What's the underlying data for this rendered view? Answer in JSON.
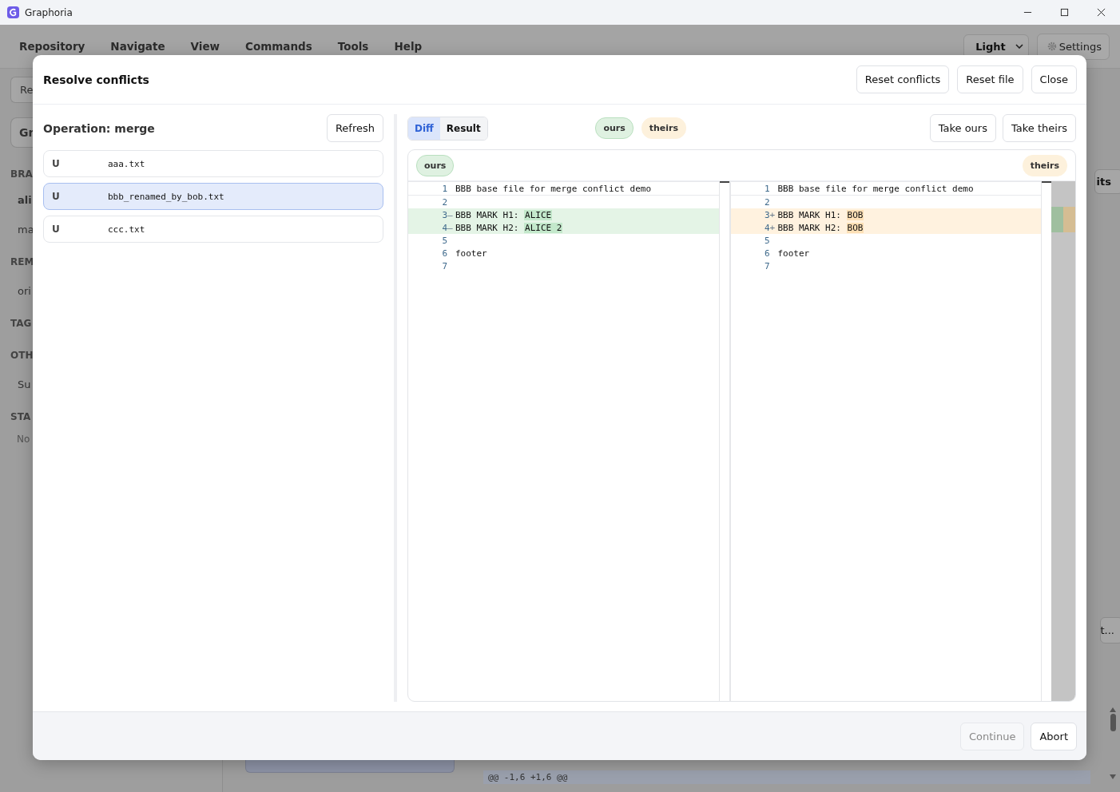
{
  "window": {
    "title": "Graphoria"
  },
  "menu": [
    "Repository",
    "Navigate",
    "View",
    "Commands",
    "Tools",
    "Help"
  ],
  "theme_select": {
    "value": "Light"
  },
  "settings_button": {
    "label": "Settings"
  },
  "background": {
    "sidebar": [
      {
        "text": "Re",
        "kind": "button"
      },
      {
        "text": "Gr",
        "kind": "bigbutton"
      },
      {
        "text": "BRA",
        "kind": "header"
      },
      {
        "text": "ali",
        "kind": "current"
      },
      {
        "text": "ma",
        "kind": "item"
      },
      {
        "text": "REM",
        "kind": "header"
      },
      {
        "text": "ori",
        "kind": "item"
      },
      {
        "text": "TAG",
        "kind": "header"
      },
      {
        "text": "OTH",
        "kind": "header"
      },
      {
        "text": "Su",
        "kind": "item"
      },
      {
        "text": "STA",
        "kind": "header"
      },
      {
        "text": "No",
        "kind": "muted"
      }
    ],
    "right": [
      {
        "text": "its",
        "kind": "bold"
      },
      {
        "text": "t...",
        "kind": "plain"
      }
    ],
    "diff_line": "@@ -1,6 +1,6 @@"
  },
  "dialog": {
    "title": "Resolve conflicts",
    "header_buttons": [
      "Reset conflicts",
      "Reset file",
      "Close"
    ],
    "operation": "Operation: merge",
    "refresh": "Refresh",
    "files": [
      {
        "status": "U",
        "name": "aaa.txt",
        "selected": false
      },
      {
        "status": "U",
        "name": "bbb_renamed_by_bob.txt",
        "selected": true
      },
      {
        "status": "U",
        "name": "ccc.txt",
        "selected": false
      }
    ],
    "view_tabs": [
      {
        "label": "Diff",
        "selected": true
      },
      {
        "label": "Result",
        "selected": false
      }
    ],
    "legend": [
      {
        "label": "ours",
        "kind": "ours"
      },
      {
        "label": "theirs",
        "kind": "theirs"
      }
    ],
    "take_buttons": [
      "Take ours",
      "Take theirs"
    ],
    "panes": [
      {
        "label": "ours",
        "kind": "ours",
        "lines": [
          {
            "num": "1",
            "text": "BBB base file for merge conflict demo",
            "changed": false
          },
          {
            "num": "2",
            "changed": false
          },
          {
            "num": "3",
            "sign": "—",
            "text": "BBB MARK H1: ",
            "highlight": "ALICE",
            "changed": true
          },
          {
            "num": "4",
            "sign": "—",
            "text": "BBB MARK H2: ",
            "highlight": "ALICE 2",
            "changed": true
          },
          {
            "num": "5",
            "changed": false
          },
          {
            "num": "6",
            "text": "footer",
            "changed": false
          },
          {
            "num": "7",
            "changed": false
          }
        ]
      },
      {
        "label": "theirs",
        "kind": "theirs",
        "lines": [
          {
            "num": "1",
            "text": "BBB base file for merge conflict demo",
            "changed": false
          },
          {
            "num": "2",
            "changed": false
          },
          {
            "num": "3",
            "sign": "+",
            "text": "BBB MARK H1: ",
            "highlight": "BOB",
            "changed": true
          },
          {
            "num": "4",
            "sign": "+",
            "text": "BBB MARK H2: ",
            "highlight": "BOB",
            "changed": true
          },
          {
            "num": "5",
            "changed": false
          },
          {
            "num": "6",
            "text": "footer",
            "changed": false
          },
          {
            "num": "7",
            "changed": false
          }
        ]
      }
    ],
    "footer": {
      "continue": {
        "label": "Continue",
        "disabled": true
      },
      "abort": "Abort"
    }
  }
}
